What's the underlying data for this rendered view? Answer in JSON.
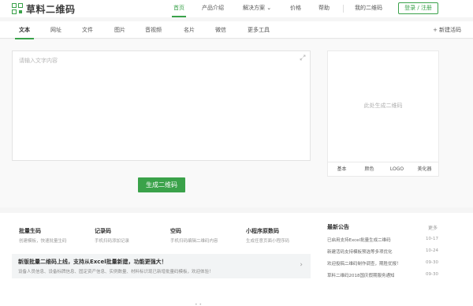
{
  "header": {
    "logo_text": "草料二维码",
    "nav": [
      {
        "label": "首页",
        "active": true
      },
      {
        "label": "产品介绍",
        "active": false
      },
      {
        "label": "解决方案 ⌄",
        "active": false
      },
      {
        "label": "价格",
        "active": false
      },
      {
        "label": "帮助",
        "active": false
      },
      {
        "label": "我的二维码",
        "active": false
      }
    ],
    "login_label": "登录 / 注册"
  },
  "tabs": {
    "items": [
      "文本",
      "网址",
      "文件",
      "图片",
      "音视频",
      "名片",
      "微信",
      "更多工具"
    ],
    "active_index": 0,
    "new_label": "新建活码"
  },
  "editor": {
    "placeholder": "请输入文字内容",
    "generate_label": "生成二维码"
  },
  "preview": {
    "placeholder": "此处生成二维码",
    "tabs": [
      "基本",
      "颜色",
      "LOGO",
      "美化器"
    ]
  },
  "features": [
    {
      "title": "批量生码",
      "desc": "创建模板，快速批量生码"
    },
    {
      "title": "记录码",
      "desc": "手机扫码添加记录"
    },
    {
      "title": "空码",
      "desc": "手机扫码编辑二维码内容"
    },
    {
      "title": "小程序原数码",
      "desc": "生成任意页面小程序码"
    }
  ],
  "banner": {
    "title": "新版批量二维码上线，支持从Excel批量新建，功能更强大！",
    "desc": "设备人员信息、设备标牌信息、固定资产信息、实例数量、材料标识现已新增批量码模板，欢迎体验！"
  },
  "news": {
    "title": "最新公告",
    "more_label": "更多",
    "items": [
      {
        "text": "已启用支持Excel批量生成二维码",
        "date": "10-17"
      },
      {
        "text": "新建活码支持模板预选等多项优化",
        "date": "10-24"
      },
      {
        "text": "欢迎投稿二维码制作调查，期胜优报！",
        "date": "09-30"
      },
      {
        "text": "草料二维码2018国庆假期服务通知",
        "date": "09-30"
      }
    ]
  },
  "footer": {
    "dots": "• •"
  },
  "colors": {
    "accent": "#3aa24a"
  }
}
